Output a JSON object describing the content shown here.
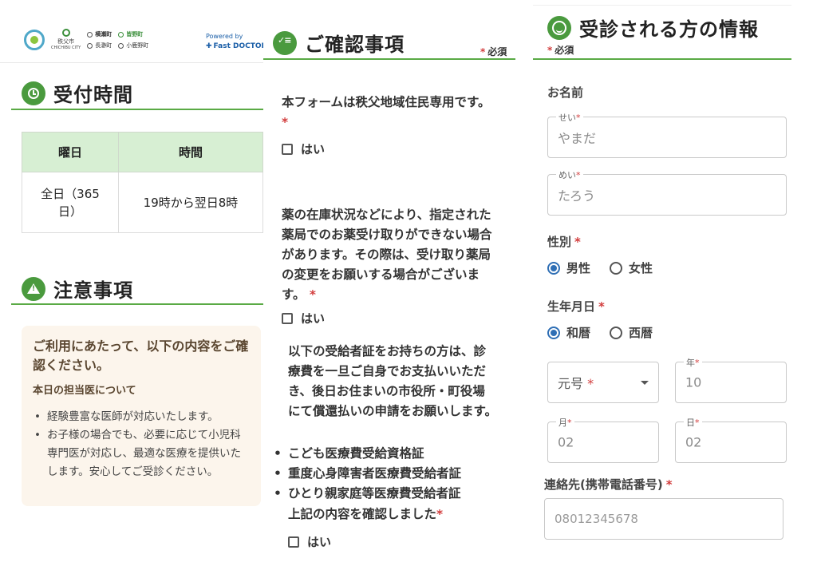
{
  "left": {
    "logos": {
      "chichibu_city": "秩父市",
      "chichibu_city_en": "CHICHIBU CITY",
      "yokoze": "横瀬町",
      "minano": "皆野町",
      "nagatoro": "長瀞町",
      "ogano": "小鹿野町"
    },
    "powered_by": "Powered by",
    "powered_brand": "Fast DOCTOR",
    "reception": {
      "title": "受付時間",
      "col_day": "曜日",
      "col_time": "時間",
      "day_value": "全日（365日）",
      "time_value": "19時から翌日8時"
    },
    "notice": {
      "title": "注意事項",
      "box_title": "ご利用にあたって、以下の内容をご確認ください。",
      "box_sub": "本日の担当医について",
      "items": [
        "経験豊富な医師が対応いたします。",
        "お子様の場合でも、必要に応じて小児科専門医が対応し、最適な医療を提供いたします。安心してご受診ください。"
      ]
    }
  },
  "mid": {
    "title": "ご確認事項",
    "required_note": "必須",
    "q1": "本フォームは秩父地域住民専用です。",
    "q2": "薬の在庫状況などにより、指定された薬局でのお薬受け取りができない場合があります。その際は、受け取り薬局の変更をお願いする場合がございます。",
    "q3_intro": "以下の受給者証をお持ちの方は、診療費を一旦ご自身でお支払いいただき、後日お住まいの市役所・町役場にて償還払いの申請をお願いします。",
    "q3_items": [
      "こども医療費受給資格証",
      "重度心身障害者医療費受給者証",
      "ひとり親家庭等医療費受給者証"
    ],
    "q3_confirm": "上記の内容を確認しました",
    "check_label": "はい",
    "star": "*"
  },
  "right": {
    "title": "受診される方の情報",
    "required_note": "必須",
    "name_label": "お名前",
    "sei_legend": "せい",
    "sei_value": "やまだ",
    "mei_legend": "めい",
    "mei_value": "たろう",
    "gender_label": "性別",
    "gender_male": "男性",
    "gender_female": "女性",
    "birth_label": "生年月日",
    "era_wareki": "和暦",
    "era_seireki": "西暦",
    "era_select": "元号",
    "year_legend": "年",
    "year_value": "10",
    "month_legend": "月",
    "month_value": "02",
    "day_legend": "日",
    "day_value": "02",
    "phone_label": "連絡先(携帯電話番号)",
    "phone_placeholder": "08012345678",
    "star": "*"
  }
}
